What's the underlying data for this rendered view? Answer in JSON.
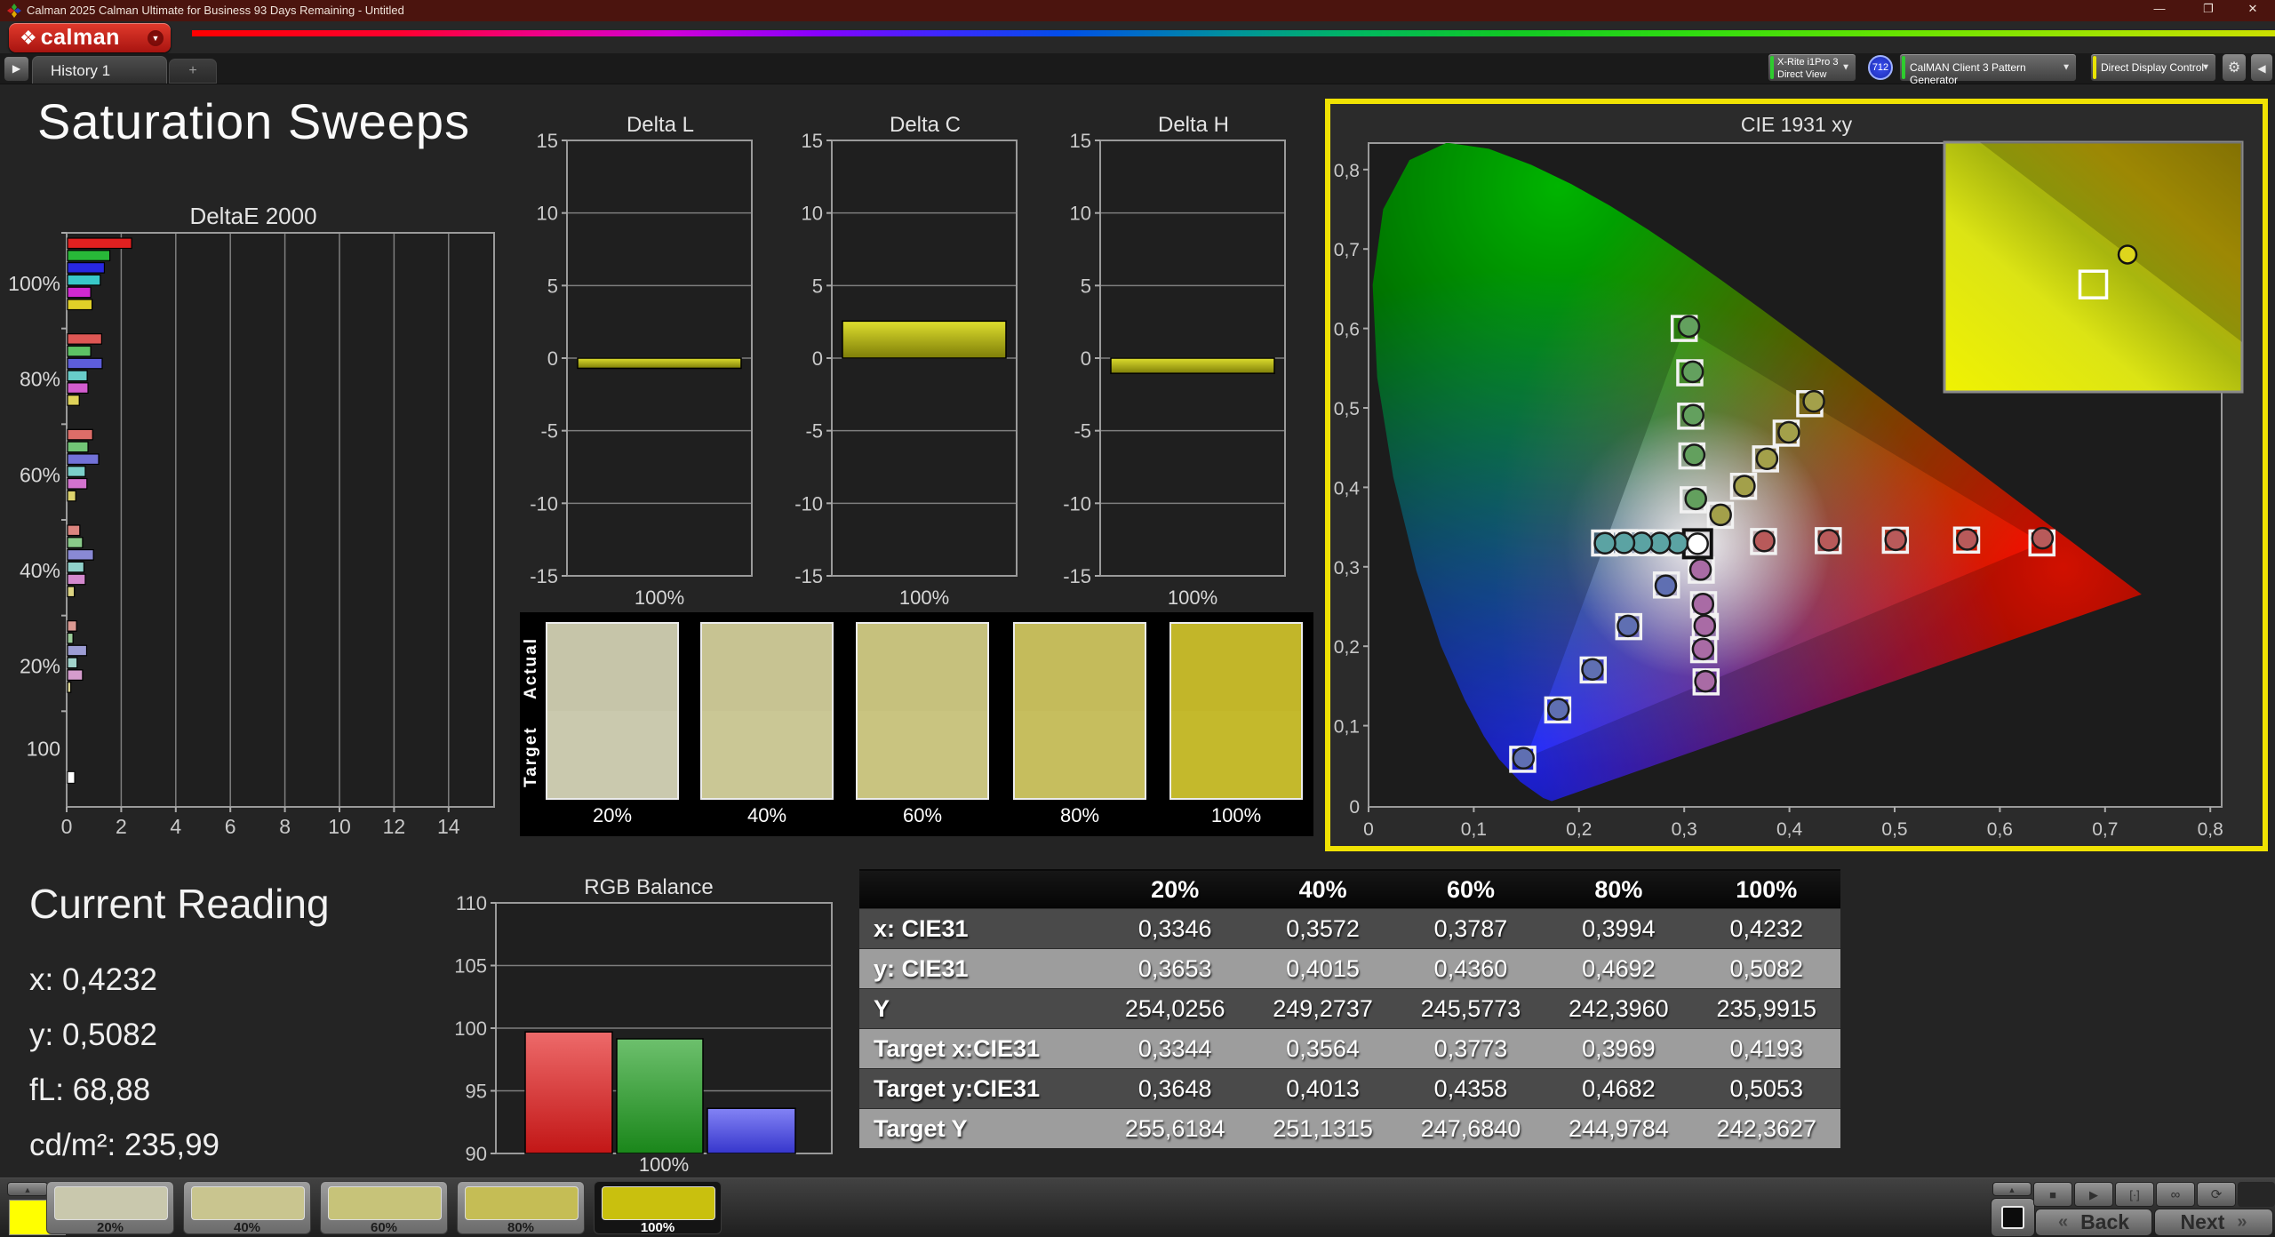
{
  "window": {
    "title": "Calman 2025 Calman Ultimate for Business 93 Days Remaining  - Untitled"
  },
  "icons": {
    "logo_diamond": "❖",
    "chevron_down": "▼",
    "scroll_right": "▶",
    "add_tab": "+",
    "up_arrow": "▲",
    "gear": "⚙",
    "collapse_left": "◀",
    "stop": "■",
    "play": "▶",
    "pattern": "[·]",
    "infinity": "∞",
    "refresh": "⟳",
    "back_chevron": "«",
    "next_chevron": "»",
    "minimize": "—",
    "restore": "❐",
    "close": "✕"
  },
  "brand": {
    "name": "calman"
  },
  "tabbar": {
    "tabs": [
      {
        "label": "History 1",
        "active": true
      }
    ]
  },
  "toolbar": {
    "meter": {
      "line1": "X-Rite i1Pro 3",
      "line2": "Direct View",
      "badge": "712",
      "status_color": "#2ecc2e"
    },
    "pattern_generator": "CalMAN Client 3 Pattern Generator",
    "pattern_status_color": "#2ecc2e",
    "display_control": "Direct Display Control",
    "display_status_color": "#e8e400"
  },
  "page_title": "Saturation Sweeps",
  "current_reading": {
    "title": "Current Reading",
    "items": [
      "x: 0,4232",
      "y: 0,5082",
      "fL: 68,88",
      "cd/m²: 235,99"
    ]
  },
  "results_table": {
    "columns": [
      "20%",
      "40%",
      "60%",
      "80%",
      "100%"
    ],
    "rows": [
      {
        "label": "x: CIE31",
        "values": [
          "0,3346",
          "0,3572",
          "0,3787",
          "0,3994",
          "0,4232"
        ]
      },
      {
        "label": "y: CIE31",
        "values": [
          "0,3653",
          "0,4015",
          "0,4360",
          "0,4692",
          "0,5082"
        ]
      },
      {
        "label": "Y",
        "values": [
          "254,0256",
          "249,2737",
          "245,5773",
          "242,3960",
          "235,9915"
        ]
      },
      {
        "label": "Target x:CIE31",
        "values": [
          "0,3344",
          "0,3564",
          "0,3773",
          "0,3969",
          "0,4193"
        ]
      },
      {
        "label": "Target y:CIE31",
        "values": [
          "0,3648",
          "0,4013",
          "0,4358",
          "0,4682",
          "0,5053"
        ]
      },
      {
        "label": "Target Y",
        "values": [
          "255,6184",
          "251,1315",
          "247,6840",
          "244,9784",
          "242,3627"
        ]
      }
    ]
  },
  "swatch_panel": {
    "row_labels": [
      "Actual",
      "Target"
    ],
    "columns": [
      "20%",
      "40%",
      "60%",
      "80%",
      "100%"
    ],
    "actual_colors": [
      "#c6c5a9",
      "#c7c392",
      "#c6c17d",
      "#c4bb5b",
      "#c2b629"
    ],
    "target_colors": [
      "#cac9ae",
      "#cac795",
      "#c9c480",
      "#c6be5e",
      "#c4b92c"
    ]
  },
  "bottom_bar": {
    "preview_color": "#ffff00",
    "swatches": [
      {
        "label": "20%",
        "color": "#c9c8ad",
        "selected": false
      },
      {
        "label": "40%",
        "color": "#c9c58f",
        "selected": false
      },
      {
        "label": "60%",
        "color": "#c7c379",
        "selected": false
      },
      {
        "label": "80%",
        "color": "#c5bd55",
        "selected": false
      },
      {
        "label": "100%",
        "color": "#c9c00e",
        "selected": true
      }
    ],
    "back": "Back",
    "next": "Next"
  },
  "chart_data": [
    {
      "id": "deltae2000",
      "type": "bar",
      "orientation": "horizontal",
      "title": "DeltaE 2000",
      "groups": [
        "100%",
        "80%",
        "60%",
        "40%",
        "20%",
        "100"
      ],
      "channels": [
        "red",
        "green",
        "blue",
        "cyan",
        "magenta",
        "yellow"
      ],
      "channel_colors": [
        "#e02020",
        "#28b838",
        "#2828e0",
        "#38c8c8",
        "#d028d0",
        "#e0d028"
      ],
      "pastel": [
        0,
        0.3,
        0.42,
        0.55,
        0.66,
        0
      ],
      "white_bar_color": "#ffffff",
      "values": [
        [
          2.35,
          1.55,
          1.35,
          1.2,
          0.85,
          0.9
        ],
        [
          1.25,
          0.85,
          1.27,
          0.72,
          0.75,
          0.43
        ],
        [
          0.92,
          0.75,
          1.14,
          0.65,
          0.71,
          0.3
        ],
        [
          0.45,
          0.55,
          0.95,
          0.6,
          0.65,
          0.25
        ],
        [
          0.33,
          0.2,
          0.7,
          0.35,
          0.55,
          0.12
        ],
        [
          0.26
        ]
      ],
      "xticks": [
        0,
        2,
        4,
        6,
        8,
        10,
        12,
        14
      ],
      "xlim": [
        0,
        15.6
      ]
    },
    {
      "id": "delta_l",
      "type": "bar",
      "title": "Delta L",
      "categories": [
        "100%"
      ],
      "values": [
        -0.7
      ],
      "yticks": [
        15,
        10,
        5,
        0,
        -5,
        -10,
        -15
      ],
      "ylim": [
        -15,
        15
      ],
      "bar_color": "#c6c61e"
    },
    {
      "id": "delta_c",
      "type": "bar",
      "title": "Delta C",
      "categories": [
        "100%"
      ],
      "values": [
        2.55
      ],
      "yticks": [
        15,
        10,
        5,
        0,
        -5,
        -10,
        -15
      ],
      "ylim": [
        -15,
        15
      ],
      "bar_color": "#c6c61e"
    },
    {
      "id": "delta_h",
      "type": "bar",
      "title": "Delta H",
      "categories": [
        "100%"
      ],
      "values": [
        -1.05
      ],
      "yticks": [
        15,
        10,
        5,
        0,
        -5,
        -10,
        -15
      ],
      "ylim": [
        -15,
        15
      ],
      "bar_color": "#c6c61e"
    },
    {
      "id": "rgb_balance",
      "type": "bar",
      "title": "RGB Balance",
      "categories": [
        "Red",
        "Green",
        "Blue"
      ],
      "values": [
        99.7,
        99.15,
        93.6
      ],
      "yticks": [
        110,
        105,
        100,
        95,
        90
      ],
      "ylim": [
        90,
        110
      ],
      "xlabel": "100%",
      "bar_colors": [
        "#e41a1a",
        "#1e9e1e",
        "#4040f0"
      ]
    },
    {
      "id": "cie_1931_xy",
      "type": "scatter",
      "title": "CIE 1931 xy",
      "xtick_labels": [
        "0",
        "0,1",
        "0,2",
        "0,3",
        "0,4",
        "0,5",
        "0,6",
        "0,7",
        "0,8"
      ],
      "ytick_labels": [
        "0",
        "0,1",
        "0,2",
        "0,3",
        "0,4",
        "0,5",
        "0,6",
        "0,7",
        "0,8"
      ],
      "xlim": [
        0,
        0.81
      ],
      "ylim": [
        0,
        0.8335
      ],
      "gamut_triangle": [
        [
          0.64,
          0.33
        ],
        [
          0.3,
          0.6
        ],
        [
          0.15,
          0.06
        ]
      ],
      "white_point": {
        "target": [
          0.3127,
          0.329
        ],
        "actual": [
          0.3127,
          0.329
        ]
      },
      "sweeps": [
        {
          "name": "red",
          "marker_color": "#b85a5a",
          "targets": [
            [
              0.3754,
              0.3318
            ],
            [
              0.4369,
              0.3329
            ],
            [
              0.5007,
              0.3334
            ],
            [
              0.5684,
              0.3336
            ],
            [
              0.64,
              0.33
            ]
          ],
          "actuals": [
            [
              0.376,
              0.3325
            ],
            [
              0.4375,
              0.3335
            ],
            [
              0.501,
              0.334
            ],
            [
              0.569,
              0.3345
            ],
            [
              0.6405,
              0.336
            ]
          ]
        },
        {
          "name": "green",
          "marker_color": "#63a05e",
          "targets": [
            [
              0.3085,
              0.3843
            ],
            [
              0.3073,
              0.4395
            ],
            [
              0.3061,
              0.4896
            ],
            [
              0.3053,
              0.5442
            ],
            [
              0.3,
              0.6
            ]
          ],
          "actuals": [
            [
              0.311,
              0.3855
            ],
            [
              0.3095,
              0.4408
            ],
            [
              0.3085,
              0.4908
            ],
            [
              0.308,
              0.5455
            ],
            [
              0.3045,
              0.6025
            ]
          ]
        },
        {
          "name": "blue",
          "marker_color": "#5f6fb2",
          "targets": [
            [
              0.2831,
              0.2771
            ],
            [
              0.2473,
              0.2247
            ],
            [
              0.2135,
              0.1701
            ],
            [
              0.1798,
              0.1198
            ],
            [
              0.1465,
              0.0577
            ]
          ],
          "actuals": [
            [
              0.2825,
              0.2762
            ],
            [
              0.2466,
              0.2255
            ],
            [
              0.2128,
              0.1709
            ],
            [
              0.1805,
              0.1206
            ],
            [
              0.1472,
              0.059
            ]
          ]
        },
        {
          "name": "cyan",
          "marker_color": "#5ba3a3",
          "targets": [
            [
              0.2941,
              0.3301
            ],
            [
              0.2771,
              0.3302
            ],
            [
              0.2601,
              0.3303
            ],
            [
              0.2431,
              0.3304
            ],
            [
              0.2243,
              0.3299
            ]
          ],
          "actuals": [
            [
              0.2937,
              0.3298
            ],
            [
              0.2768,
              0.33
            ],
            [
              0.2597,
              0.3301
            ],
            [
              0.2428,
              0.3301
            ],
            [
              0.2247,
              0.3297
            ]
          ]
        },
        {
          "name": "magenta",
          "marker_color": "#a96ba5",
          "targets": [
            [
              0.3162,
              0.2958
            ],
            [
              0.3184,
              0.2523
            ],
            [
              0.3201,
              0.2249
            ],
            [
              0.3185,
              0.1957
            ],
            [
              0.3208,
              0.1551
            ]
          ],
          "actuals": [
            [
              0.3155,
              0.2965
            ],
            [
              0.3178,
              0.2531
            ],
            [
              0.3195,
              0.2257
            ],
            [
              0.3179,
              0.1964
            ],
            [
              0.3202,
              0.1559
            ]
          ]
        },
        {
          "name": "yellow",
          "marker_color": "#a3a04a",
          "targets": [
            [
              0.3344,
              0.3648
            ],
            [
              0.3564,
              0.4013
            ],
            [
              0.3773,
              0.4358
            ],
            [
              0.3969,
              0.4682
            ],
            [
              0.4193,
              0.5053
            ]
          ],
          "actuals": [
            [
              0.3346,
              0.3653
            ],
            [
              0.3572,
              0.4015
            ],
            [
              0.3787,
              0.436
            ],
            [
              0.3994,
              0.4692
            ],
            [
              0.4232,
              0.5082
            ]
          ]
        }
      ],
      "inset": {
        "square": [
          0.5,
          0.57
        ],
        "circle": [
          0.615,
          0.45
        ]
      }
    }
  ]
}
